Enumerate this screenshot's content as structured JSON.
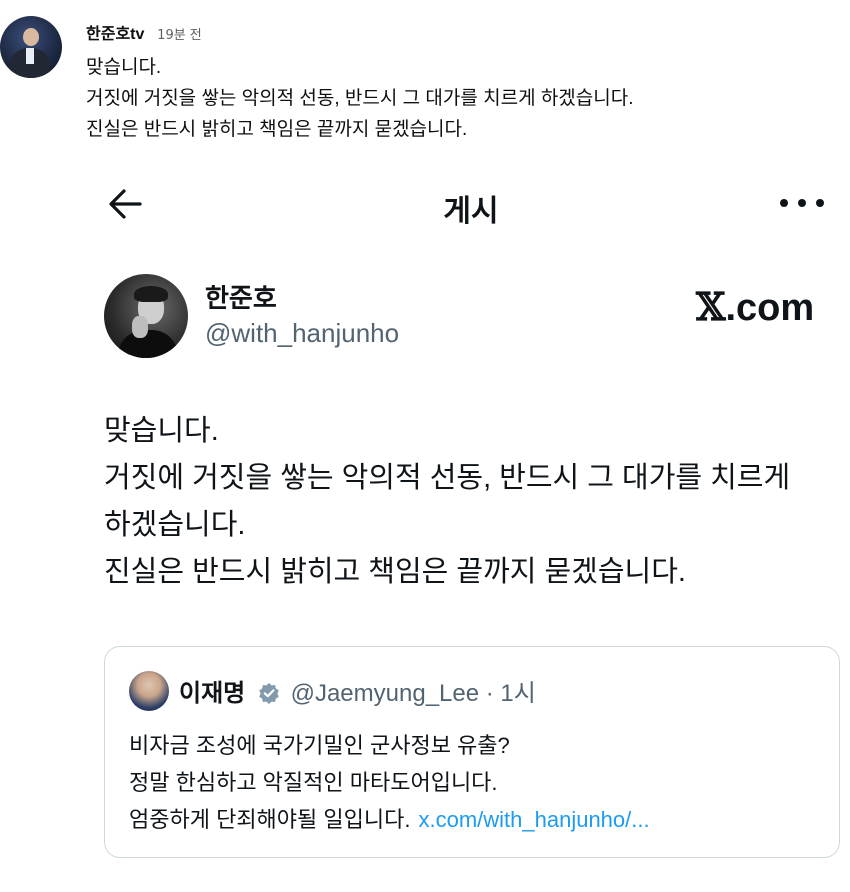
{
  "comment": {
    "author": "한준호tv",
    "time": "19분 전",
    "lines": [
      "맞습니다.",
      "거짓에 거짓을 쌓는 악의적 선동, 반드시 그 대가를 치르게 하겠습니다.",
      "진실은 반드시 밝히고 책임은 끝까지 묻겠습니다."
    ]
  },
  "x_post": {
    "header_title": "게시",
    "author_name": "한준호",
    "author_handle": "@with_hanjunho",
    "logo_text": ".com",
    "logo_mark": "𝕏",
    "body_lines": [
      "맞습니다.",
      "거짓에 거짓을 쌓는 악의적 선동, 반드시 그 대가를 치르게",
      "하겠습니다.",
      "진실은 반드시 밝히고 책임은 끝까지 묻겠습니다."
    ],
    "quote": {
      "name": "이재명",
      "handle_time": "@Jaemyung_Lee · 1시",
      "lines": [
        "비자금 조성에  국가기밀인 군사정보 유출?",
        "정말 한심하고 악질적인 마타도어입니다."
      ],
      "last_line": "엄중하게 단죄해야될 일입니다.",
      "link": "x.com/with_hanjunho/..."
    }
  },
  "colors": {
    "link": "#1d9bf0",
    "secondary_text": "#536471",
    "verified_badge": "#829aab"
  }
}
